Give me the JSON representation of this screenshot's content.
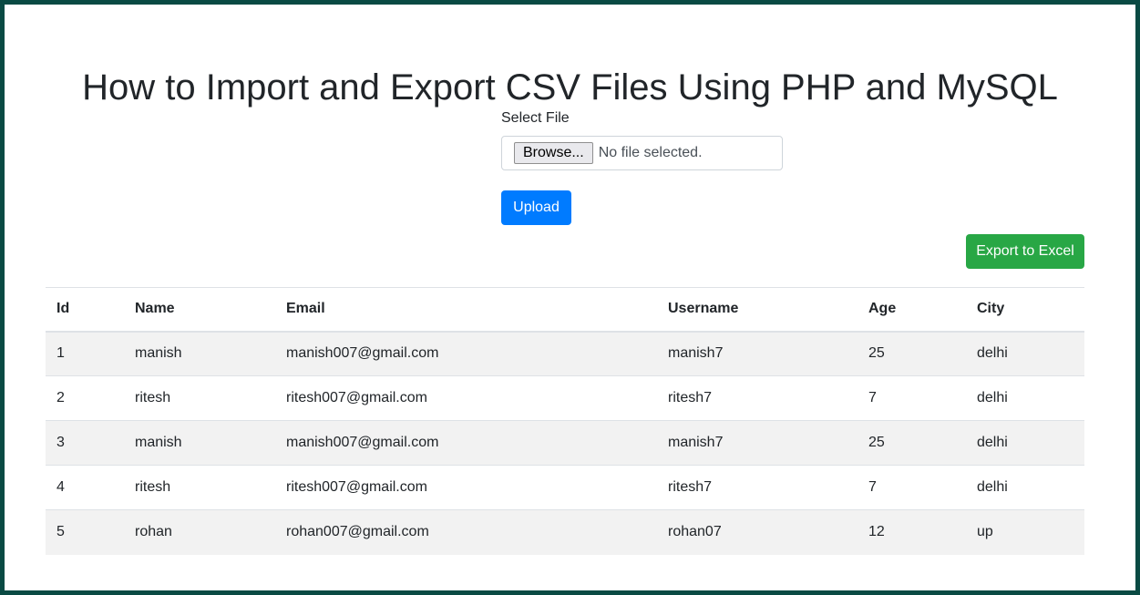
{
  "page": {
    "title": "How to Import and Export CSV Files Using PHP and MySQL"
  },
  "upload": {
    "label": "Select File",
    "browse_label": "Browse...",
    "file_status": "No file selected.",
    "submit_label": "Upload"
  },
  "export": {
    "label": "Export to Excel"
  },
  "colors": {
    "primary": "#007bff",
    "success": "#28a745",
    "frame": "#0a4a43",
    "stripe": "#f2f2f2"
  },
  "table": {
    "headers": [
      "Id",
      "Name",
      "Email",
      "Username",
      "Age",
      "City"
    ],
    "rows": [
      [
        "1",
        "manish",
        "manish007@gmail.com",
        "manish7",
        "25",
        "delhi"
      ],
      [
        "2",
        "ritesh",
        "ritesh007@gmail.com",
        "ritesh7",
        "7",
        "delhi"
      ],
      [
        "3",
        "manish",
        "manish007@gmail.com",
        "manish7",
        "25",
        "delhi"
      ],
      [
        "4",
        "ritesh",
        "ritesh007@gmail.com",
        "ritesh7",
        "7",
        "delhi"
      ],
      [
        "5",
        "rohan",
        "rohan007@gmail.com",
        "rohan07",
        "12",
        "up"
      ]
    ]
  }
}
